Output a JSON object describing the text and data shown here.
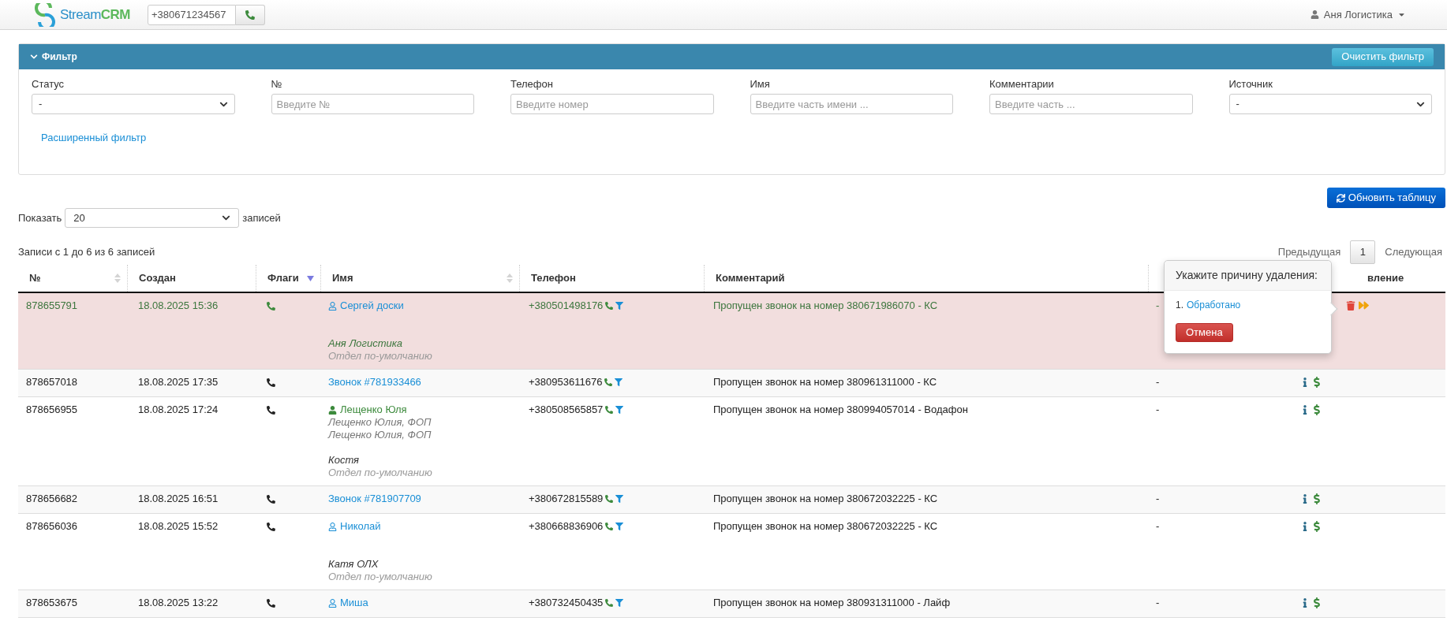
{
  "topbar": {
    "brand": {
      "part_1": "Stream",
      "part_2": "CRM"
    },
    "dial": {
      "value": "+380671234567"
    },
    "user": {
      "name": "Аня Логистика"
    }
  },
  "filter": {
    "title": "Фильтр",
    "clear_button": "Очистить фильтр",
    "advanced_link": "Расширенный фильтр",
    "fields": [
      {
        "kind": "select",
        "label": "Статус",
        "value": "-"
      },
      {
        "kind": "input",
        "label": "№",
        "placeholder": "Введите №"
      },
      {
        "kind": "input",
        "label": "Телефон",
        "placeholder": "Введите номер"
      },
      {
        "kind": "input",
        "label": "Имя",
        "placeholder": "Введите часть имени ..."
      },
      {
        "kind": "input",
        "label": "Комментарии",
        "placeholder": "Введите часть ..."
      },
      {
        "kind": "select",
        "label": "Источник",
        "value": "-"
      }
    ]
  },
  "refresh_button": "Обновить таблицу",
  "page_size": {
    "label_before": "Показать",
    "value": "20",
    "label_after": "записей"
  },
  "records_info": "Записи с 1 до 6 из 6 записей",
  "pagination": {
    "previous": "Предыдущая",
    "pages": [
      {
        "label": "1",
        "selected": true
      }
    ],
    "next": "Следующая"
  },
  "table": {
    "columns": [
      {
        "label": "№",
        "sortable": true,
        "sorted": false
      },
      {
        "label": "Создан",
        "sortable": false,
        "sorted": false
      },
      {
        "label": "Флаги",
        "sortable": true,
        "sorted": true
      },
      {
        "label": "Имя",
        "sortable": true,
        "sorted": false
      },
      {
        "label": "Телефон",
        "sortable": false,
        "sorted": false
      },
      {
        "label": "Комментарий",
        "sortable": false,
        "sorted": false
      },
      {},
      {
        "label": "вление",
        "sortable": false,
        "sorted": false
      }
    ],
    "rows": [
      {
        "highlighted": true,
        "deleting": true,
        "number": "878655791",
        "created": "18.08.2025 15:36",
        "name": {
          "kind": "contact",
          "text": "Сергей доски"
        },
        "companies": [],
        "manager": {
          "name": "Аня Логистика",
          "department": "Отдел по-умолчанию"
        },
        "phone": "+380501498176",
        "comment": "Пропущен звонок на номер 380671986070 - КС",
        "column_7": "-"
      },
      {
        "highlighted": false,
        "deleting": false,
        "number": "878657018",
        "created": "18.08.2025 17:35",
        "name": {
          "kind": "call",
          "text": "Звонок #781933466"
        },
        "companies": [],
        "phone": "+380953611676",
        "comment": "Пропущен звонок на номер 380961311000 - КС",
        "column_7": "-"
      },
      {
        "highlighted": false,
        "deleting": false,
        "number": "878656955",
        "created": "18.08.2025 17:24",
        "name": {
          "kind": "client",
          "text": "Лещенко Юля"
        },
        "companies": [
          "Лещенко Юлия, ФОП",
          "Лещенко Юлия, ФОП"
        ],
        "manager": {
          "name": "Костя",
          "department": "Отдел по-умолчанию"
        },
        "phone": "+380508565857",
        "comment": "Пропущен звонок на номер 380994057014 - Водафон",
        "column_7": "-"
      },
      {
        "highlighted": false,
        "deleting": false,
        "number": "878656682",
        "created": "18.08.2025 16:51",
        "name": {
          "kind": "call",
          "text": "Звонок #781907709"
        },
        "companies": [],
        "phone": "+380672815589",
        "comment": "Пропущен звонок на номер 380672032225 - КС",
        "column_7": "-"
      },
      {
        "highlighted": false,
        "deleting": false,
        "number": "878656036",
        "created": "18.08.2025 15:52",
        "name": {
          "kind": "contact",
          "text": "Николай"
        },
        "companies": [],
        "manager": {
          "name": "Катя ОЛХ",
          "department": "Отдел по-умолчанию"
        },
        "phone": "+380668836906",
        "comment": "Пропущен звонок на номер 380672032225 - КС",
        "column_7": "-"
      },
      {
        "highlighted": false,
        "deleting": false,
        "number": "878653675",
        "created": "18.08.2025 13:22",
        "name": {
          "kind": "contact",
          "text": "Миша"
        },
        "companies": [],
        "phone": "+380732450435",
        "comment": "Пропущен звонок на номер 380931311000 - Лайф",
        "column_7": "-"
      }
    ]
  },
  "delete_popover": {
    "title": "Укажите причину удаления:",
    "reasons": [
      {
        "index": "1.",
        "label": "Обработано"
      }
    ],
    "cancel_button": "Отмена"
  }
}
